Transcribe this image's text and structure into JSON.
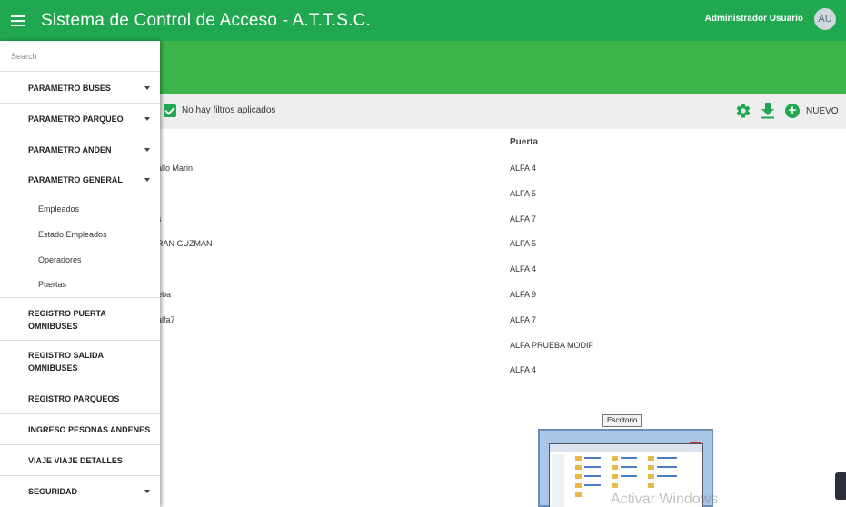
{
  "app": {
    "title": "Sistema de Control de Acceso - A.T.T.S.C.",
    "user_name": "Administrador Usuario",
    "user_initials": "AU",
    "accent_color": "#1fa84f"
  },
  "toolbar": {
    "filter_text": "No hay filtros aplicados",
    "new_label": "NUEVO"
  },
  "table": {
    "columns": [
      "Puerta"
    ],
    "rows": [
      {
        "nombre": "allo Marin",
        "puerta": "ALFA 4"
      },
      {
        "nombre": "",
        "puerta": "ALFA 5"
      },
      {
        "nombre": "s",
        "puerta": "ALFA 7"
      },
      {
        "nombre": "RAN GUZMAN",
        "puerta": "ALFA 5"
      },
      {
        "nombre": "",
        "puerta": "ALFA 4"
      },
      {
        "nombre": "eba",
        "puerta": "ALFA 9"
      },
      {
        "nombre": "alfa7",
        "puerta": "ALFA 7"
      },
      {
        "nombre": "",
        "puerta": "ALFA PRUEBA MODIF"
      },
      {
        "nombre": "",
        "puerta": "ALFA 4"
      }
    ]
  },
  "sidebar": {
    "search_placeholder": "Search",
    "items": [
      {
        "label": "PARAMETRO BUSES",
        "expandable": true
      },
      {
        "label": "PARAMETRO PARQUEO",
        "expandable": true
      },
      {
        "label": "PARAMETRO ANDEN",
        "expandable": true
      },
      {
        "label": "PARAMETRO GENERAL",
        "expandable": true
      },
      {
        "label": "REGISTRO PUERTA OMNIBUSES",
        "expandable": false
      },
      {
        "label": "REGISTRO SALIDA OMNIBUSES",
        "expandable": false
      },
      {
        "label": "REGISTRO PARQUEOS",
        "expandable": false
      },
      {
        "label": "INGRESO PESONAS ANDENES",
        "expandable": false
      },
      {
        "label": "VIAJE VIAJE DETALLES",
        "expandable": false
      },
      {
        "label": "SEGURIDAD",
        "expandable": true
      }
    ],
    "subitems": [
      "Empleados",
      "Estado Empleados",
      "Operadores",
      "Puertas"
    ]
  },
  "overlay": {
    "tooltip": "Escritorio",
    "watermark": "Activar Windows"
  }
}
